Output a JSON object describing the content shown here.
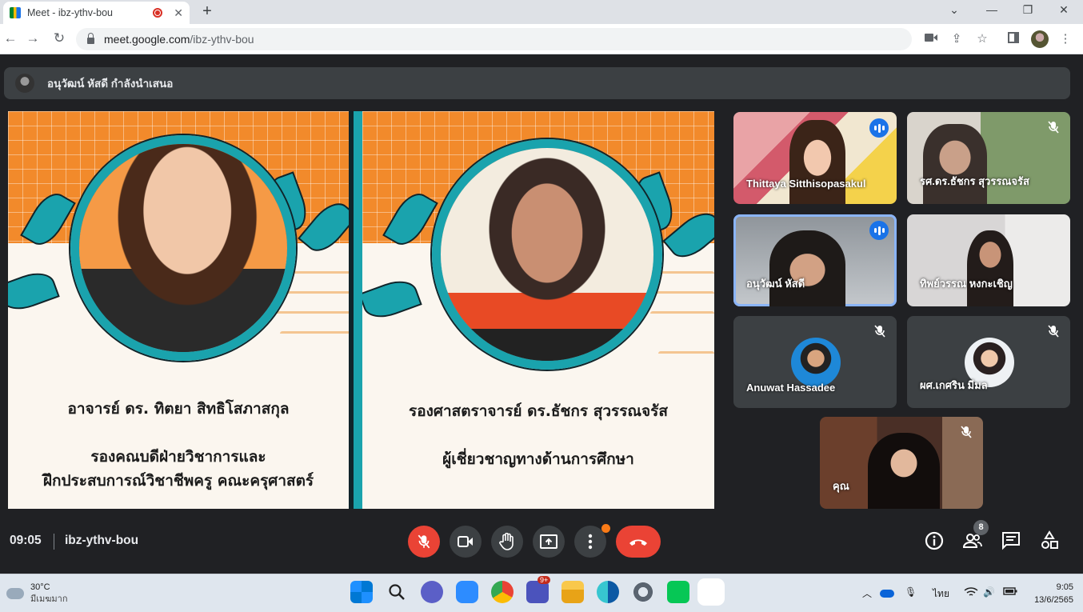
{
  "browser": {
    "tab_title": "Meet - ibz-ythv-bou",
    "tab_close": "✕",
    "new_tab": "+",
    "url_host": "meet.google.com",
    "url_path": "/ibz-ythv-bou"
  },
  "meet": {
    "presenting_banner": "อนุวัฒน์ หัสดี กำลังนำเสนอ",
    "slide_left": {
      "name": "อาจารย์ ดร. ทิตยา  สิทธิโสภาสกุล",
      "role_line1": "รองคณบดีฝ่ายวิชาการและ",
      "role_line2": "ฝึกประสบการณ์วิชาชีพครู คณะครุศาสตร์"
    },
    "slide_right": {
      "name": "รองศาสตราจารย์ ดร.ธัชกร สุวรรณจรัส",
      "role": "ผู้เชี่ยวชาญทางด้านการศึกษา"
    },
    "participants": [
      {
        "name": "Thittaya Sitthisopasakul",
        "state": "speaking"
      },
      {
        "name": "รศ.ดร.ธัชกร สุวรรณจรัส",
        "state": "muted"
      },
      {
        "name": "อนุวัฒน์ หัสดี",
        "state": "speaking"
      },
      {
        "name": "ทิพย์วรรณ หงกะเชิญ",
        "state": ""
      },
      {
        "name": "Anuwat Hassadee",
        "state": "muted"
      },
      {
        "name": "ผศ.เกศริน มีมล",
        "state": "muted"
      },
      {
        "name": "คุณ",
        "state": "muted"
      }
    ],
    "time": "09:05",
    "meeting_code": "ibz-ythv-bou",
    "people_count": "8"
  },
  "taskbar": {
    "temperature": "30°C",
    "weather": "มีเมฆมาก",
    "language": "ไทย",
    "time": "9:05",
    "date": "13/6/2565",
    "teams_badge": "9+"
  },
  "colors": {
    "accent_blue": "#1a73e8",
    "end_red": "#ea4335",
    "slide_orange": "#f28a2b",
    "slide_teal": "#1aa3ad"
  }
}
